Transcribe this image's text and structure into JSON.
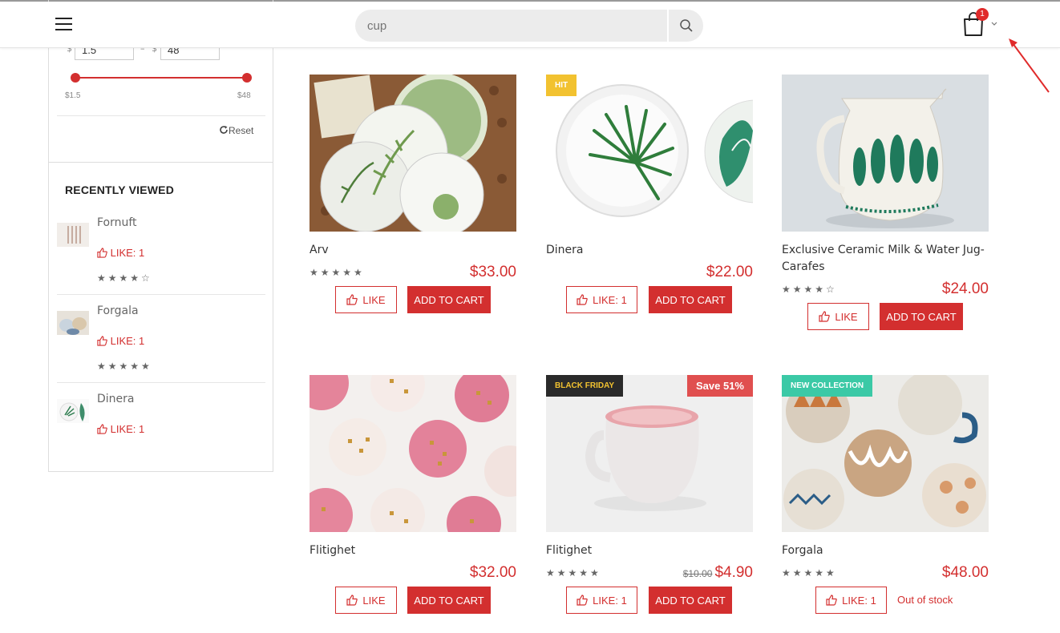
{
  "header": {
    "search_placeholder": "cup",
    "cart_count": "1"
  },
  "sidebar": {
    "price_filter": {
      "currency": "$",
      "separator": "–",
      "min_value": "1.5",
      "max_value": "48",
      "min_label": "$1.5",
      "max_label": "$48",
      "reset_label": "Reset"
    },
    "recently_viewed": {
      "title": "RECENTLY VIEWED",
      "items": [
        {
          "name": "Fornuft",
          "like": "LIKE: 1",
          "stars": "★★★★☆"
        },
        {
          "name": "Forgala",
          "like": "LIKE: 1",
          "stars": "★★★★★"
        },
        {
          "name": "Dinera",
          "like": "LIKE: 1",
          "stars": ""
        }
      ]
    }
  },
  "products": [
    {
      "title": "Arv",
      "price": "$33.00",
      "old_price": "",
      "stars": "★★★★★",
      "like": "LIKE",
      "cart": "ADD TO CART",
      "badge": "",
      "sale": ""
    },
    {
      "title": "Dinera",
      "price": "$22.00",
      "old_price": "",
      "stars": "",
      "like": "LIKE: 1",
      "cart": "ADD TO CART",
      "badge": "HIT",
      "sale": ""
    },
    {
      "title": "Exclusive Ceramic Milk & Water Jug-Carafes",
      "price": "$24.00",
      "old_price": "",
      "stars": "★★★★☆",
      "like": "LIKE",
      "cart": "ADD TO CART",
      "badge": "",
      "sale": ""
    },
    {
      "title": "Flitighet",
      "price": "$32.00",
      "old_price": "",
      "stars": "",
      "like": "LIKE",
      "cart": "ADD TO CART",
      "badge": "",
      "sale": ""
    },
    {
      "title": "Flitighet",
      "price": "$4.90",
      "old_price": "$10.00",
      "stars": "★★★★★",
      "like": "LIKE: 1",
      "cart": "ADD TO CART",
      "badge": "BLACK FRIDAY",
      "sale": "Save 51%"
    },
    {
      "title": "Forgala",
      "price": "$48.00",
      "old_price": "",
      "stars": "★★★★★",
      "like": "LIKE: 1",
      "cart": "",
      "badge": "NEW COLLECTION",
      "sale": "",
      "stock": "Out of stock"
    }
  ],
  "colors": {
    "accent": "#d32f2f",
    "badge_hit": "#f2c230",
    "badge_black_friday": "#2a2a2a",
    "badge_black_friday_text": "#f2c230",
    "badge_new": "#3bc9a6",
    "badge_sale": "#e04f4f"
  }
}
